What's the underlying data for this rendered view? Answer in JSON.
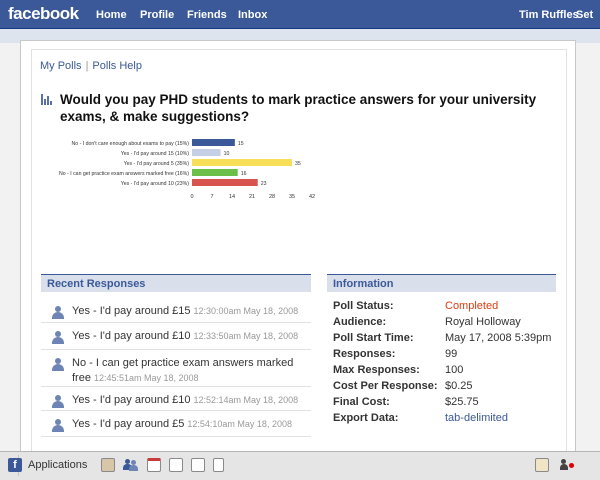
{
  "topbar": {
    "logo": "facebook",
    "nav": [
      "Home",
      "Profile",
      "Friends",
      "Inbox"
    ],
    "user": "Tim Ruffles",
    "settings": "Set"
  },
  "subnav": {
    "my_polls": "My Polls",
    "separator": "|",
    "polls_help": "Polls Help"
  },
  "question": "Would you pay PHD students to mark practice answers for your university exams, & make suggestions?",
  "chart_data": {
    "type": "bar",
    "orientation": "horizontal",
    "categories": [
      "No - I don't care enough about exams to pay (15%)",
      "Yes - I'd pay around 15 (10%)",
      "Yes - I'd pay around 5 (35%)",
      "No - I can get practice exam answers marked free (16%)",
      "Yes - I'd pay around 10 (23%)"
    ],
    "values": [
      15,
      10,
      35,
      16,
      23
    ],
    "value_labels": [
      "15",
      "10",
      "35",
      "16",
      "23"
    ],
    "colors": [
      "#3b5998",
      "#c5d0e6",
      "#f7df5a",
      "#6cc04a",
      "#d9534f"
    ],
    "xticks": [
      "0",
      "7",
      "14",
      "21",
      "28",
      "35",
      "42"
    ],
    "xlim": [
      0,
      42
    ],
    "title": "",
    "xlabel": "",
    "ylabel": ""
  },
  "recent": {
    "title": "Recent Responses",
    "items": [
      {
        "text": "Yes - I'd pay around £15",
        "time": "12:30:00am May 18, 2008"
      },
      {
        "text": "Yes - I'd pay around £10",
        "time": "12:33:50am May 18, 2008"
      },
      {
        "text": "No - I can get practice exam answers marked free",
        "time": "12:45:51am May 18, 2008"
      },
      {
        "text": "Yes - I'd pay around £10",
        "time": "12:52:14am May 18, 2008"
      },
      {
        "text": "Yes - I'd pay around £5",
        "time": "12:54:10am May 18, 2008"
      }
    ]
  },
  "info": {
    "title": "Information",
    "rows": [
      {
        "key": "Poll Status:",
        "value": "Completed"
      },
      {
        "key": "Audience:",
        "value": "Royal Holloway"
      },
      {
        "key": "Poll Start Time:",
        "value": "May 17, 2008 5:39pm"
      },
      {
        "key": "Responses:",
        "value": "99"
      },
      {
        "key": "Max Responses:",
        "value": "100"
      },
      {
        "key": "Cost Per Response:",
        "value": "$0.25"
      },
      {
        "key": "Final Cost:",
        "value": "$25.75"
      },
      {
        "key": "Export Data:",
        "value": "tab-delimited"
      }
    ],
    "status_color": "#dd3c10",
    "link_color": "#3b5998"
  },
  "bottombar": {
    "applications": "Applications",
    "icons": [
      "photos-icon",
      "friends-icon",
      "events-calendar-icon",
      "notes-icon",
      "posted-items-icon",
      "document-icon",
      "chat-icon",
      "online-friends-icon"
    ]
  }
}
